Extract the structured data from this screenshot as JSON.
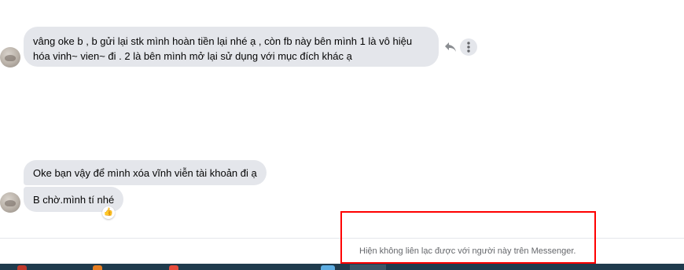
{
  "conversation": {
    "messages": [
      {
        "text": "vâng oke b , b gửi lại stk mình hoàn tiền lại nhé ạ , còn fb này bên mình 1 là vô hiệu\nhóa vinh~ vien~ đi . 2 là bên mình mở lại sử dụng với mục đích khác ạ"
      },
      {
        "text": "Oke bạn vậy để mình xóa vĩnh viễn tài khoản đi ạ"
      },
      {
        "text": "B chờ.mình tí nhé",
        "reaction": "👍"
      }
    ],
    "icons": {
      "reply": "reply-icon",
      "more": "more-options-icon",
      "avatar": "avatar"
    }
  },
  "footer": {
    "notice": "Hiện không liên lạc được với người này trên Messenger."
  },
  "colors": {
    "bubble": "#e4e6eb",
    "highlight": "#ff0000",
    "notice_text": "#65676b",
    "taskbar": "#1f3b4d"
  }
}
